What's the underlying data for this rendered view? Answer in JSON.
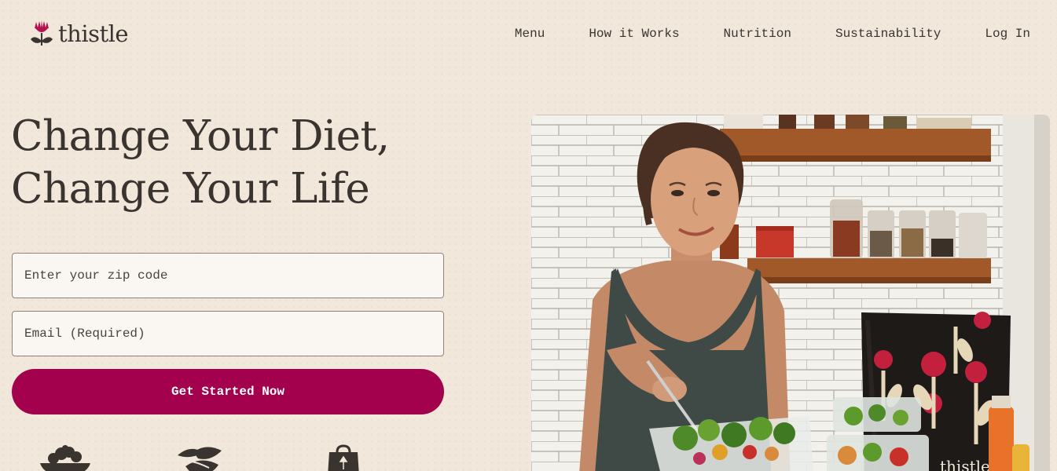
{
  "brand": {
    "name": "thistle",
    "accent_color": "#a3004d",
    "background_color": "#f1e8db"
  },
  "nav": {
    "items": [
      {
        "label": "Menu"
      },
      {
        "label": "How it Works"
      },
      {
        "label": "Nutrition"
      },
      {
        "label": "Sustainability"
      },
      {
        "label": "Log In"
      }
    ]
  },
  "hero": {
    "title_line1": "Change Your Diet,",
    "title_line2": "Change Your Life"
  },
  "form": {
    "zip_placeholder": "Enter your zip code",
    "email_placeholder": "Email (Required)",
    "cta_label": "Get Started Now"
  },
  "features": {
    "icons": [
      "salad-bowl-icon",
      "leaf-icon",
      "shopping-bag-icon"
    ]
  },
  "photo": {
    "product_brand_text": "thistle"
  }
}
